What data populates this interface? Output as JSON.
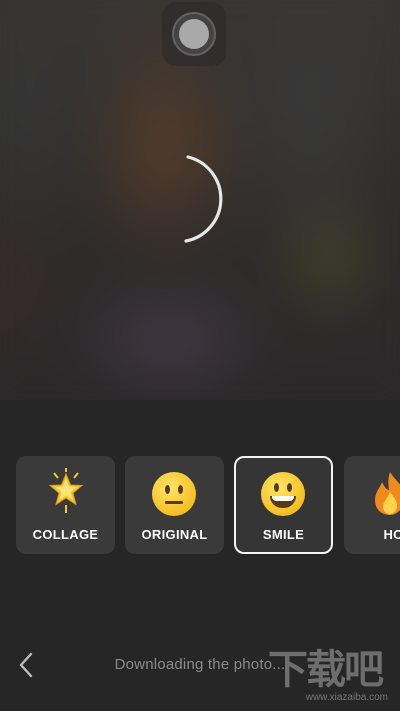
{
  "camera": {
    "shutter_icon": "shutter-button-icon",
    "loading_icon": "loading-spinner-icon"
  },
  "filters": [
    {
      "label": "COLLAGE",
      "icon": "star-sparkle-icon",
      "selected": false
    },
    {
      "label": "ORIGINAL",
      "icon": "neutral-face-icon",
      "selected": false
    },
    {
      "label": "SMILE",
      "icon": "grinning-face-icon",
      "selected": true
    },
    {
      "label": "HO",
      "icon": "fire-icon",
      "selected": false
    }
  ],
  "footer": {
    "back_icon": "chevron-left-icon",
    "status": "Downloading the photo..."
  },
  "watermark": {
    "main": "下载吧",
    "url": "www.xiazaiba.com"
  },
  "colors": {
    "background": "#262626",
    "card": "#3a3a3a",
    "selected_border": "#f2f2f2",
    "status_text": "#8a8a8a"
  }
}
